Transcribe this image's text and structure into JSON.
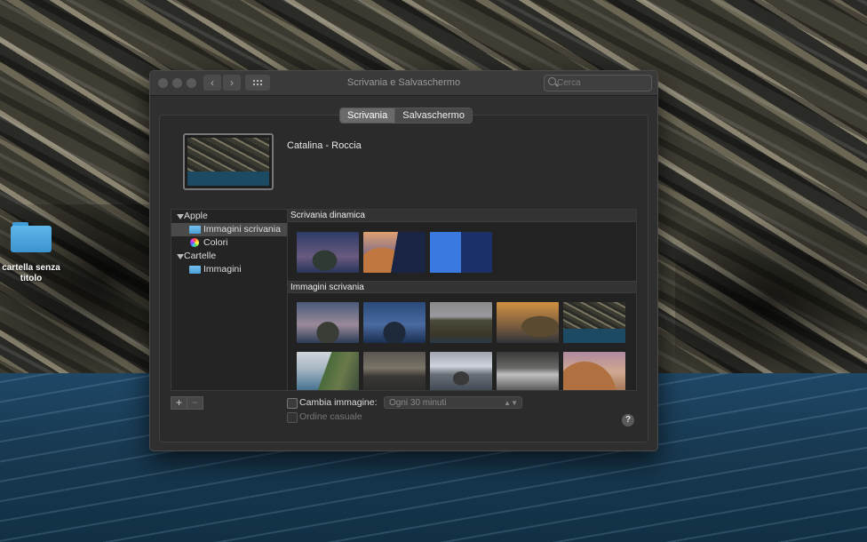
{
  "desktop": {
    "folder_label": "cartella senza titolo"
  },
  "window": {
    "title": "Scrivania e Salvaschermo",
    "search_placeholder": "Cerca",
    "tabs": [
      {
        "label": "Scrivania",
        "active": true
      },
      {
        "label": "Salvaschermo",
        "active": false
      }
    ],
    "current_wallpaper": "Catalina - Roccia"
  },
  "sidebar": {
    "groups": [
      {
        "label": "Apple",
        "items": [
          {
            "label": "Immagini scrivania",
            "icon": "folder-icon",
            "selected": true
          },
          {
            "label": "Colori",
            "icon": "color-wheel-icon",
            "selected": false
          }
        ]
      },
      {
        "label": "Cartelle",
        "items": [
          {
            "label": "Immagini",
            "icon": "folder-icon",
            "selected": false
          }
        ]
      }
    ]
  },
  "panel": {
    "sections": [
      {
        "label": "Scrivania dinamica",
        "thumbs": [
          "catalina-night",
          "mojave-dunes",
          "solar-gradient"
        ]
      },
      {
        "label": "Immagini scrivania",
        "thumbs": [
          "catalina-dusk",
          "catalina-blue",
          "catalina-coast",
          "catalina-sunset",
          "catalina-rock",
          "catalina-cliffs",
          "catalina-evening",
          "catalina-clouds",
          "catalina-mist",
          "mojave-day"
        ]
      }
    ]
  },
  "controls": {
    "plus": "+",
    "minus": "−",
    "change_picture_label": "Cambia immagine:",
    "interval_value": "Ogni 30 minuti",
    "random_order_label": "Ordine casuale",
    "help": "?"
  }
}
